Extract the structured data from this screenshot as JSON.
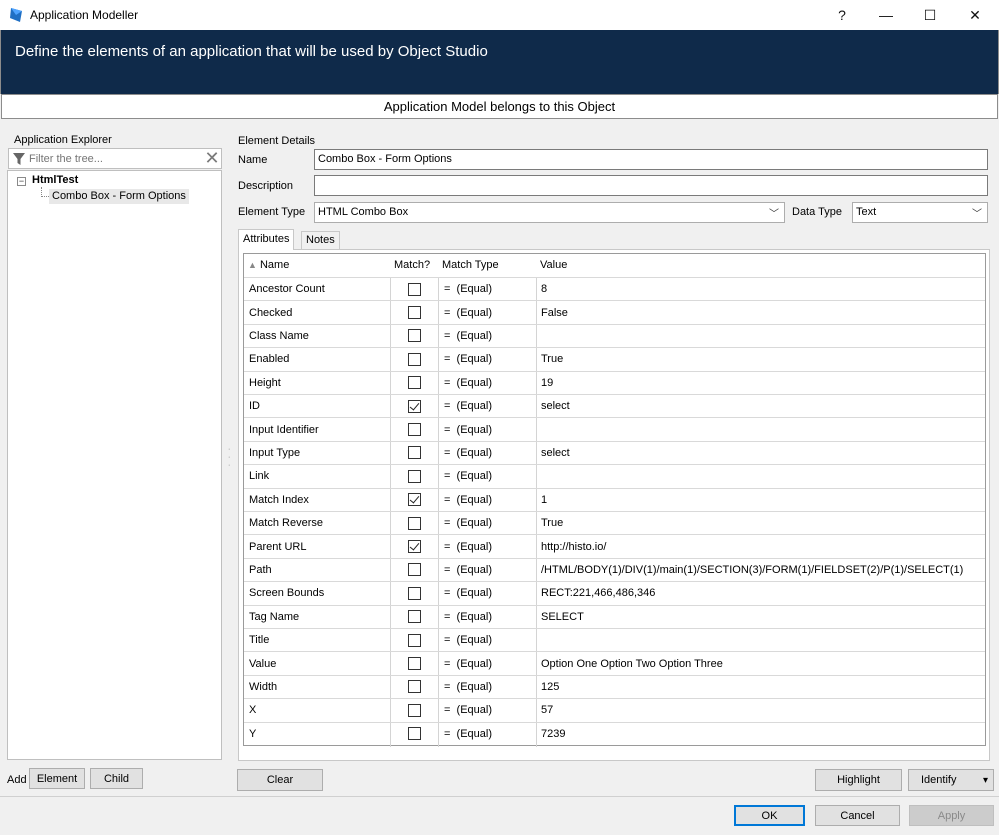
{
  "window": {
    "title": "Application Modeller",
    "help": "?",
    "minimize": "—",
    "maximize": "☐",
    "close": "✕"
  },
  "banner": {
    "text": "Define the elements of an application that will be used by Object Studio"
  },
  "subheader": {
    "text": "Application Model belongs to this Object"
  },
  "explorer": {
    "label": "Application Explorer",
    "filter_placeholder": "Filter the tree...",
    "tree": {
      "expander": "−",
      "root": "HtmlTest",
      "child": "Combo Box - Form Options"
    },
    "add_label": "Add",
    "element_button": "Element",
    "child_button": "Child"
  },
  "details": {
    "label": "Element Details",
    "name_label": "Name",
    "name_value": "Combo Box - Form Options",
    "description_label": "Description",
    "description_value": "",
    "element_type_label": "Element Type",
    "element_type_value": "HTML Combo Box",
    "data_type_label": "Data Type",
    "data_type_value": "Text"
  },
  "tabs": [
    {
      "label": "Attributes",
      "active": true
    },
    {
      "label": "Notes",
      "active": false
    }
  ],
  "grid": {
    "sort_indicator": "▲",
    "columns": [
      "Name",
      "Match?",
      "Match Type",
      "Value"
    ],
    "rows": [
      {
        "name": "Ancestor Count",
        "match": false,
        "match_type": "=  (Equal)",
        "value": "8"
      },
      {
        "name": "Checked",
        "match": false,
        "match_type": "=  (Equal)",
        "value": "False"
      },
      {
        "name": "Class Name",
        "match": false,
        "match_type": "=  (Equal)",
        "value": ""
      },
      {
        "name": "Enabled",
        "match": false,
        "match_type": "=  (Equal)",
        "value": "True"
      },
      {
        "name": "Height",
        "match": false,
        "match_type": "=  (Equal)",
        "value": "19"
      },
      {
        "name": "ID",
        "match": true,
        "match_type": "=  (Equal)",
        "value": "select"
      },
      {
        "name": "Input Identifier",
        "match": false,
        "match_type": "=  (Equal)",
        "value": ""
      },
      {
        "name": "Input Type",
        "match": false,
        "match_type": "=  (Equal)",
        "value": "select"
      },
      {
        "name": "Link",
        "match": false,
        "match_type": "=  (Equal)",
        "value": ""
      },
      {
        "name": "Match Index",
        "match": true,
        "match_type": "=  (Equal)",
        "value": "1"
      },
      {
        "name": "Match Reverse",
        "match": false,
        "match_type": "=  (Equal)",
        "value": "True"
      },
      {
        "name": "Parent URL",
        "match": true,
        "match_type": "=  (Equal)",
        "value": "http://histo.io/"
      },
      {
        "name": "Path",
        "match": false,
        "match_type": "=  (Equal)",
        "value": "/HTML/BODY(1)/DIV(1)/main(1)/SECTION(3)/FORM(1)/FIELDSET(2)/P(1)/SELECT(1)"
      },
      {
        "name": "Screen Bounds",
        "match": false,
        "match_type": "=  (Equal)",
        "value": "RECT:221,466,486,346"
      },
      {
        "name": "Tag Name",
        "match": false,
        "match_type": "=  (Equal)",
        "value": "SELECT"
      },
      {
        "name": "Title",
        "match": false,
        "match_type": "=  (Equal)",
        "value": ""
      },
      {
        "name": "Value",
        "match": false,
        "match_type": "=  (Equal)",
        "value": "Option One Option Two Option Three"
      },
      {
        "name": "Width",
        "match": false,
        "match_type": "=  (Equal)",
        "value": "125"
      },
      {
        "name": "X",
        "match": false,
        "match_type": "=  (Equal)",
        "value": "57"
      },
      {
        "name": "Y",
        "match": false,
        "match_type": "=  (Equal)",
        "value": "7239"
      }
    ]
  },
  "buttons": {
    "clear": "Clear",
    "highlight": "Highlight",
    "identify": "Identify",
    "identify_arrow": "▾",
    "ok": "OK",
    "cancel": "Cancel",
    "apply": "Apply"
  },
  "colors": {
    "banner": "#0f2a4a",
    "ok_border": "#0078d7"
  }
}
